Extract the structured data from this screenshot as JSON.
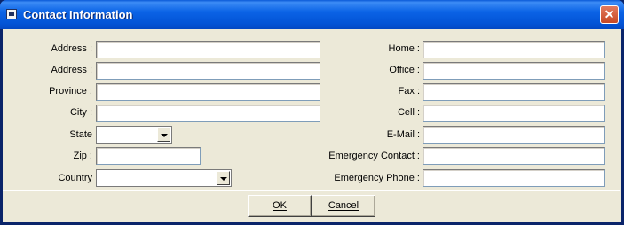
{
  "window": {
    "title": "Contact Information"
  },
  "left_fields": [
    {
      "label": "Address :",
      "value": ""
    },
    {
      "label": "Address :",
      "value": ""
    },
    {
      "label": "Province :",
      "value": ""
    },
    {
      "label": "City :",
      "value": ""
    },
    {
      "label": "State",
      "value": ""
    },
    {
      "label": "Zip :",
      "value": ""
    },
    {
      "label": "Country",
      "value": ""
    }
  ],
  "right_fields": [
    {
      "label": "Home :",
      "value": ""
    },
    {
      "label": "Office :",
      "value": ""
    },
    {
      "label": "Fax :",
      "value": ""
    },
    {
      "label": "Cell :",
      "value": ""
    },
    {
      "label": "E-Mail :",
      "value": ""
    },
    {
      "label": "Emergency Contact :",
      "value": ""
    },
    {
      "label": "Emergency Phone :",
      "value": ""
    }
  ],
  "buttons": {
    "ok": "OK",
    "cancel": "Cancel"
  },
  "icons": {
    "close": "close-icon",
    "window": "window-icon",
    "dropdown": "chevron-down-icon"
  }
}
